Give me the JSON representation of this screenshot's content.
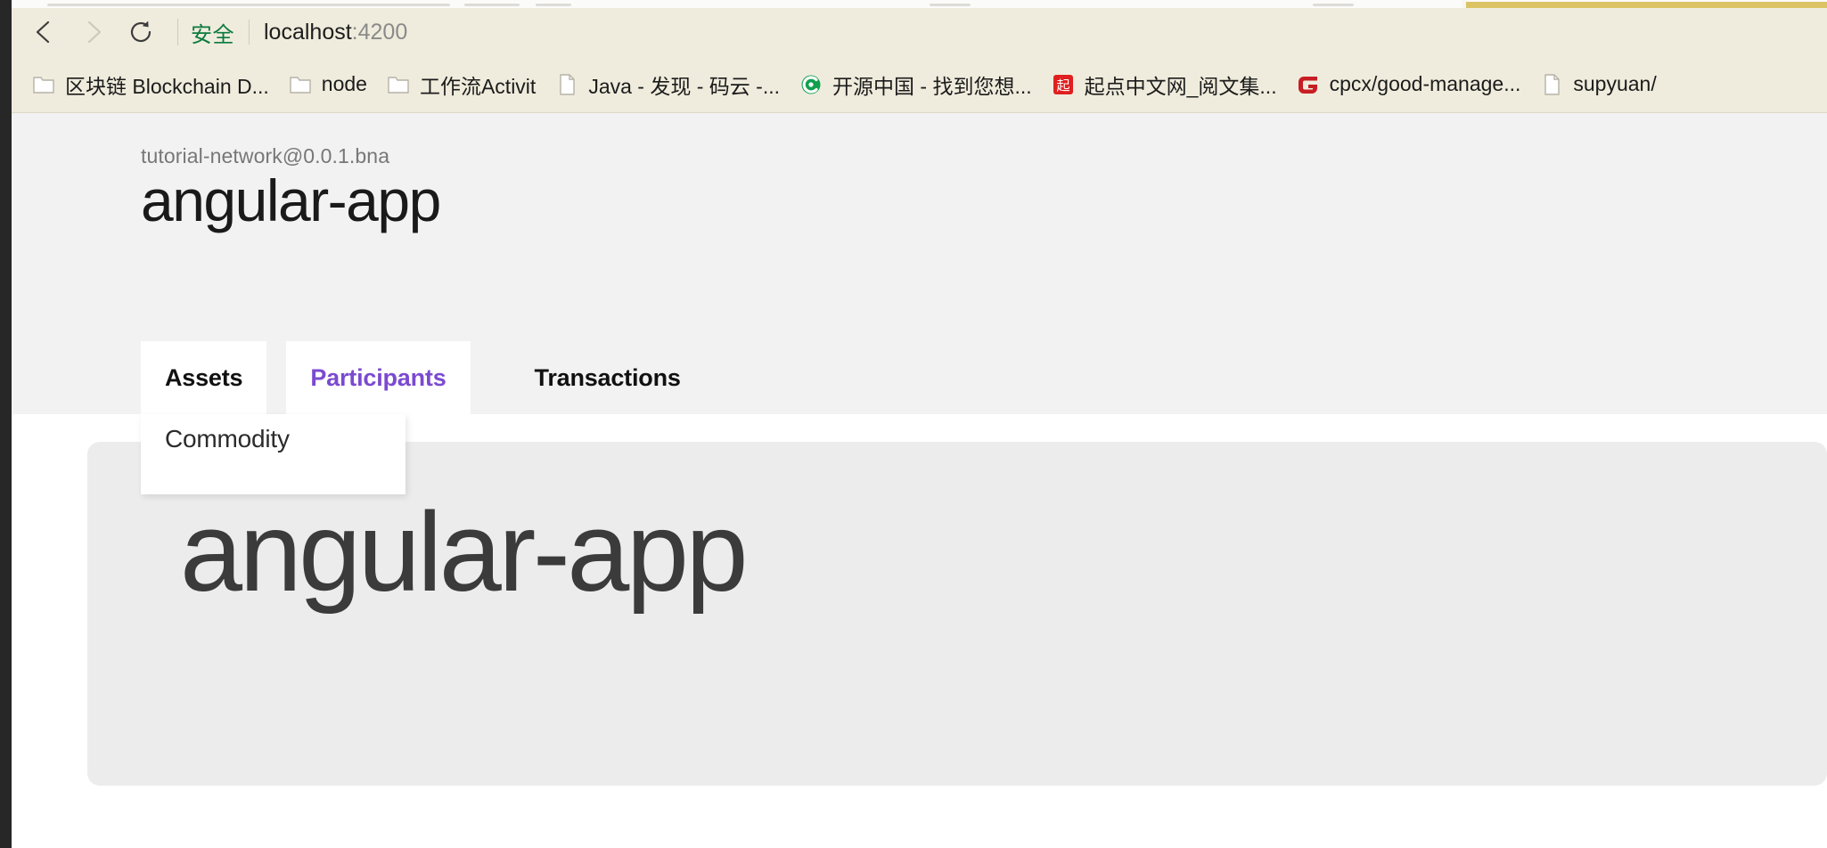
{
  "browser": {
    "nav": {
      "back_icon": "chevron-left-icon",
      "forward_icon": "chevron-right-icon",
      "reload_icon": "reload-icon",
      "back_enabled": "true",
      "forward_enabled": "false"
    },
    "omnibox": {
      "security_label": "安全",
      "url_host": "localhost",
      "url_rest": ":4200",
      "url_full": "localhost:4200",
      "security_color": "#0b7a3e"
    },
    "bookmarks": [
      {
        "label": "区块链 Blockchain D...",
        "icon": "folder-icon"
      },
      {
        "label": "node",
        "icon": "folder-icon"
      },
      {
        "label": "工作流Activit",
        "icon": "folder-icon"
      },
      {
        "label": "Java - 发现 - 码云 -...",
        "icon": "page-icon"
      },
      {
        "label": "开源中国 - 找到您想...",
        "icon": "oschina-icon"
      },
      {
        "label": "起点中文网_阅文集...",
        "icon": "qidian-icon"
      },
      {
        "label": "cpcx/good-manage...",
        "icon": "gitee-icon"
      },
      {
        "label": "supyuan/",
        "icon": "page-icon"
      }
    ]
  },
  "page": {
    "network_name": "tutorial-network@0.0.1.bna",
    "app_title": "angular-app",
    "tabs": [
      {
        "label": "Assets",
        "state": "open"
      },
      {
        "label": "Participants",
        "state": "active"
      },
      {
        "label": "Transactions",
        "state": "default"
      }
    ],
    "dropdown": {
      "owner_tab": "Assets",
      "items": [
        {
          "label": "Commodity"
        }
      ]
    },
    "content_card": {
      "title": "angular-app",
      "background": "#ececec",
      "text_color": "#3b3b3b"
    },
    "accent_color": "#7b4ad0"
  }
}
